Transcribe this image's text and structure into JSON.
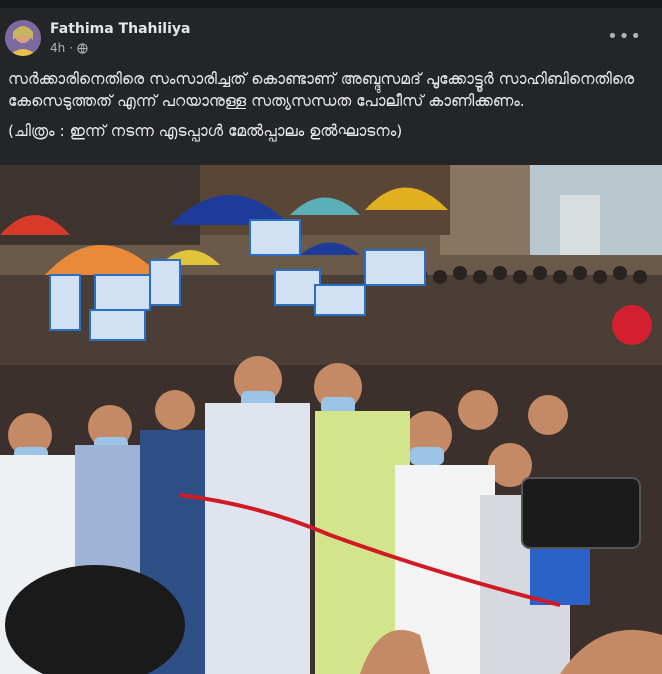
{
  "post": {
    "author": "Fathima Thahiliya",
    "time": "4h",
    "privacy_icon": "globe-icon",
    "more_icon": "more-options-icon",
    "more_label": "•••",
    "text_line1": "സർക്കാരിനെതിരെ സംസാരിച്ചത് കൊണ്ടാണ് അബ്ദുസമദ് പൂക്കോട്ടൂർ സാഹിബിനെതിരെ കേസെടുത്തത് എന്ന് പറയാനുള്ള സത്യസന്ധത പോലീസ് കാണിക്കണം.",
    "caption": "(ചിത്രം : ഇന്ന് നടന്ന എടപ്പാൾ മേൽപ്പാലം ഉൽഘാടനം)"
  },
  "colors": {
    "background": "#242526",
    "text": "#e4e6eb",
    "secondary_text": "#b0b3b8"
  }
}
